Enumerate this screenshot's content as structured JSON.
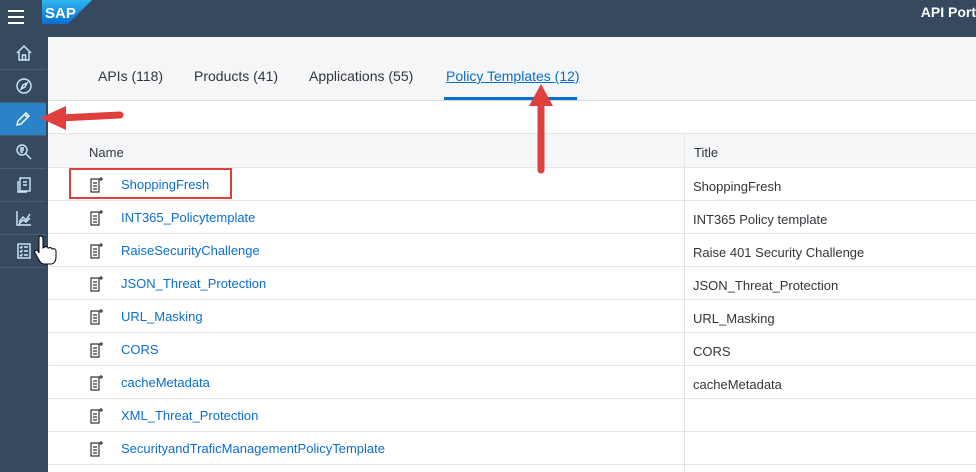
{
  "header": {
    "logo_text": "SAP",
    "app_title": "API Port"
  },
  "sidebar": {
    "items": [
      {
        "icon": "home-icon"
      },
      {
        "icon": "discover-compass-icon"
      },
      {
        "icon": "develop-pencil-icon",
        "active": true
      },
      {
        "icon": "test-search-icon"
      },
      {
        "icon": "configure-docs-icon"
      },
      {
        "icon": "analyze-chart-icon"
      },
      {
        "icon": "monetize-checklist-icon"
      }
    ]
  },
  "tabs": [
    {
      "label": "APIs (118)"
    },
    {
      "label": "Products (41)"
    },
    {
      "label": "Applications (55)"
    },
    {
      "label": "Policy Templates (12)",
      "selected": true
    }
  ],
  "table": {
    "columns": [
      "Name",
      "Title"
    ],
    "rows": [
      {
        "name": "ShoppingFresh",
        "title": "ShoppingFresh"
      },
      {
        "name": "INT365_Policytemplate",
        "title": "INT365 Policy template"
      },
      {
        "name": "RaiseSecurityChallenge",
        "title": "Raise 401 Security Challenge"
      },
      {
        "name": "JSON_Threat_Protection",
        "title": "JSON_Threat_Protection"
      },
      {
        "name": "URL_Masking",
        "title": "URL_Masking"
      },
      {
        "name": "CORS",
        "title": "CORS"
      },
      {
        "name": "cacheMetadata",
        "title": "cacheMetadata"
      },
      {
        "name": "XML_Threat_Protection",
        "title": ""
      },
      {
        "name": "SecurityandTraficManagementPolicyTemplate",
        "title": ""
      }
    ]
  },
  "colors": {
    "shell": "#354a5f",
    "active": "#2a83c7",
    "link": "#0a6ed1",
    "annotation": "#e0403b"
  }
}
